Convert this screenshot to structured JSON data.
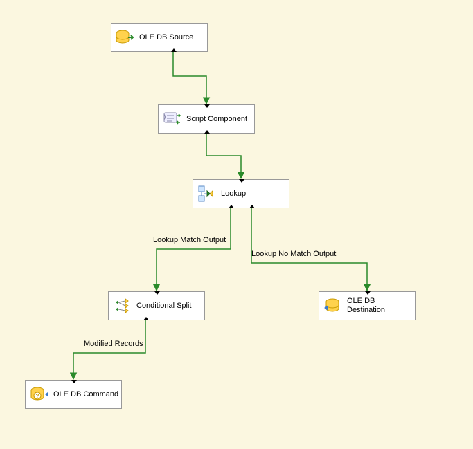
{
  "colors": {
    "background": "#fbf7e0",
    "arrow": "#2a8a2a",
    "arrow_fill": "#2a8a2a",
    "node_border": "#999999",
    "node_bg": "#ffffff"
  },
  "nodes": {
    "ole_db_source": {
      "label": "OLE DB Source",
      "icon": "db-source-icon"
    },
    "script_component": {
      "label": "Script Component",
      "icon": "script-icon"
    },
    "lookup": {
      "label": "Lookup",
      "icon": "lookup-icon"
    },
    "conditional_split": {
      "label": "Conditional Split",
      "icon": "split-icon"
    },
    "ole_db_command": {
      "label": "OLE DB Command",
      "icon": "db-command-icon"
    },
    "ole_db_destination": {
      "label": "OLE DB Destination",
      "icon": "db-destination-icon"
    }
  },
  "edges": {
    "lookup_match": {
      "label": "Lookup Match Output"
    },
    "lookup_nomatch": {
      "label": "Lookup No Match Output"
    },
    "modified_records": {
      "label": "Modified Records"
    }
  }
}
